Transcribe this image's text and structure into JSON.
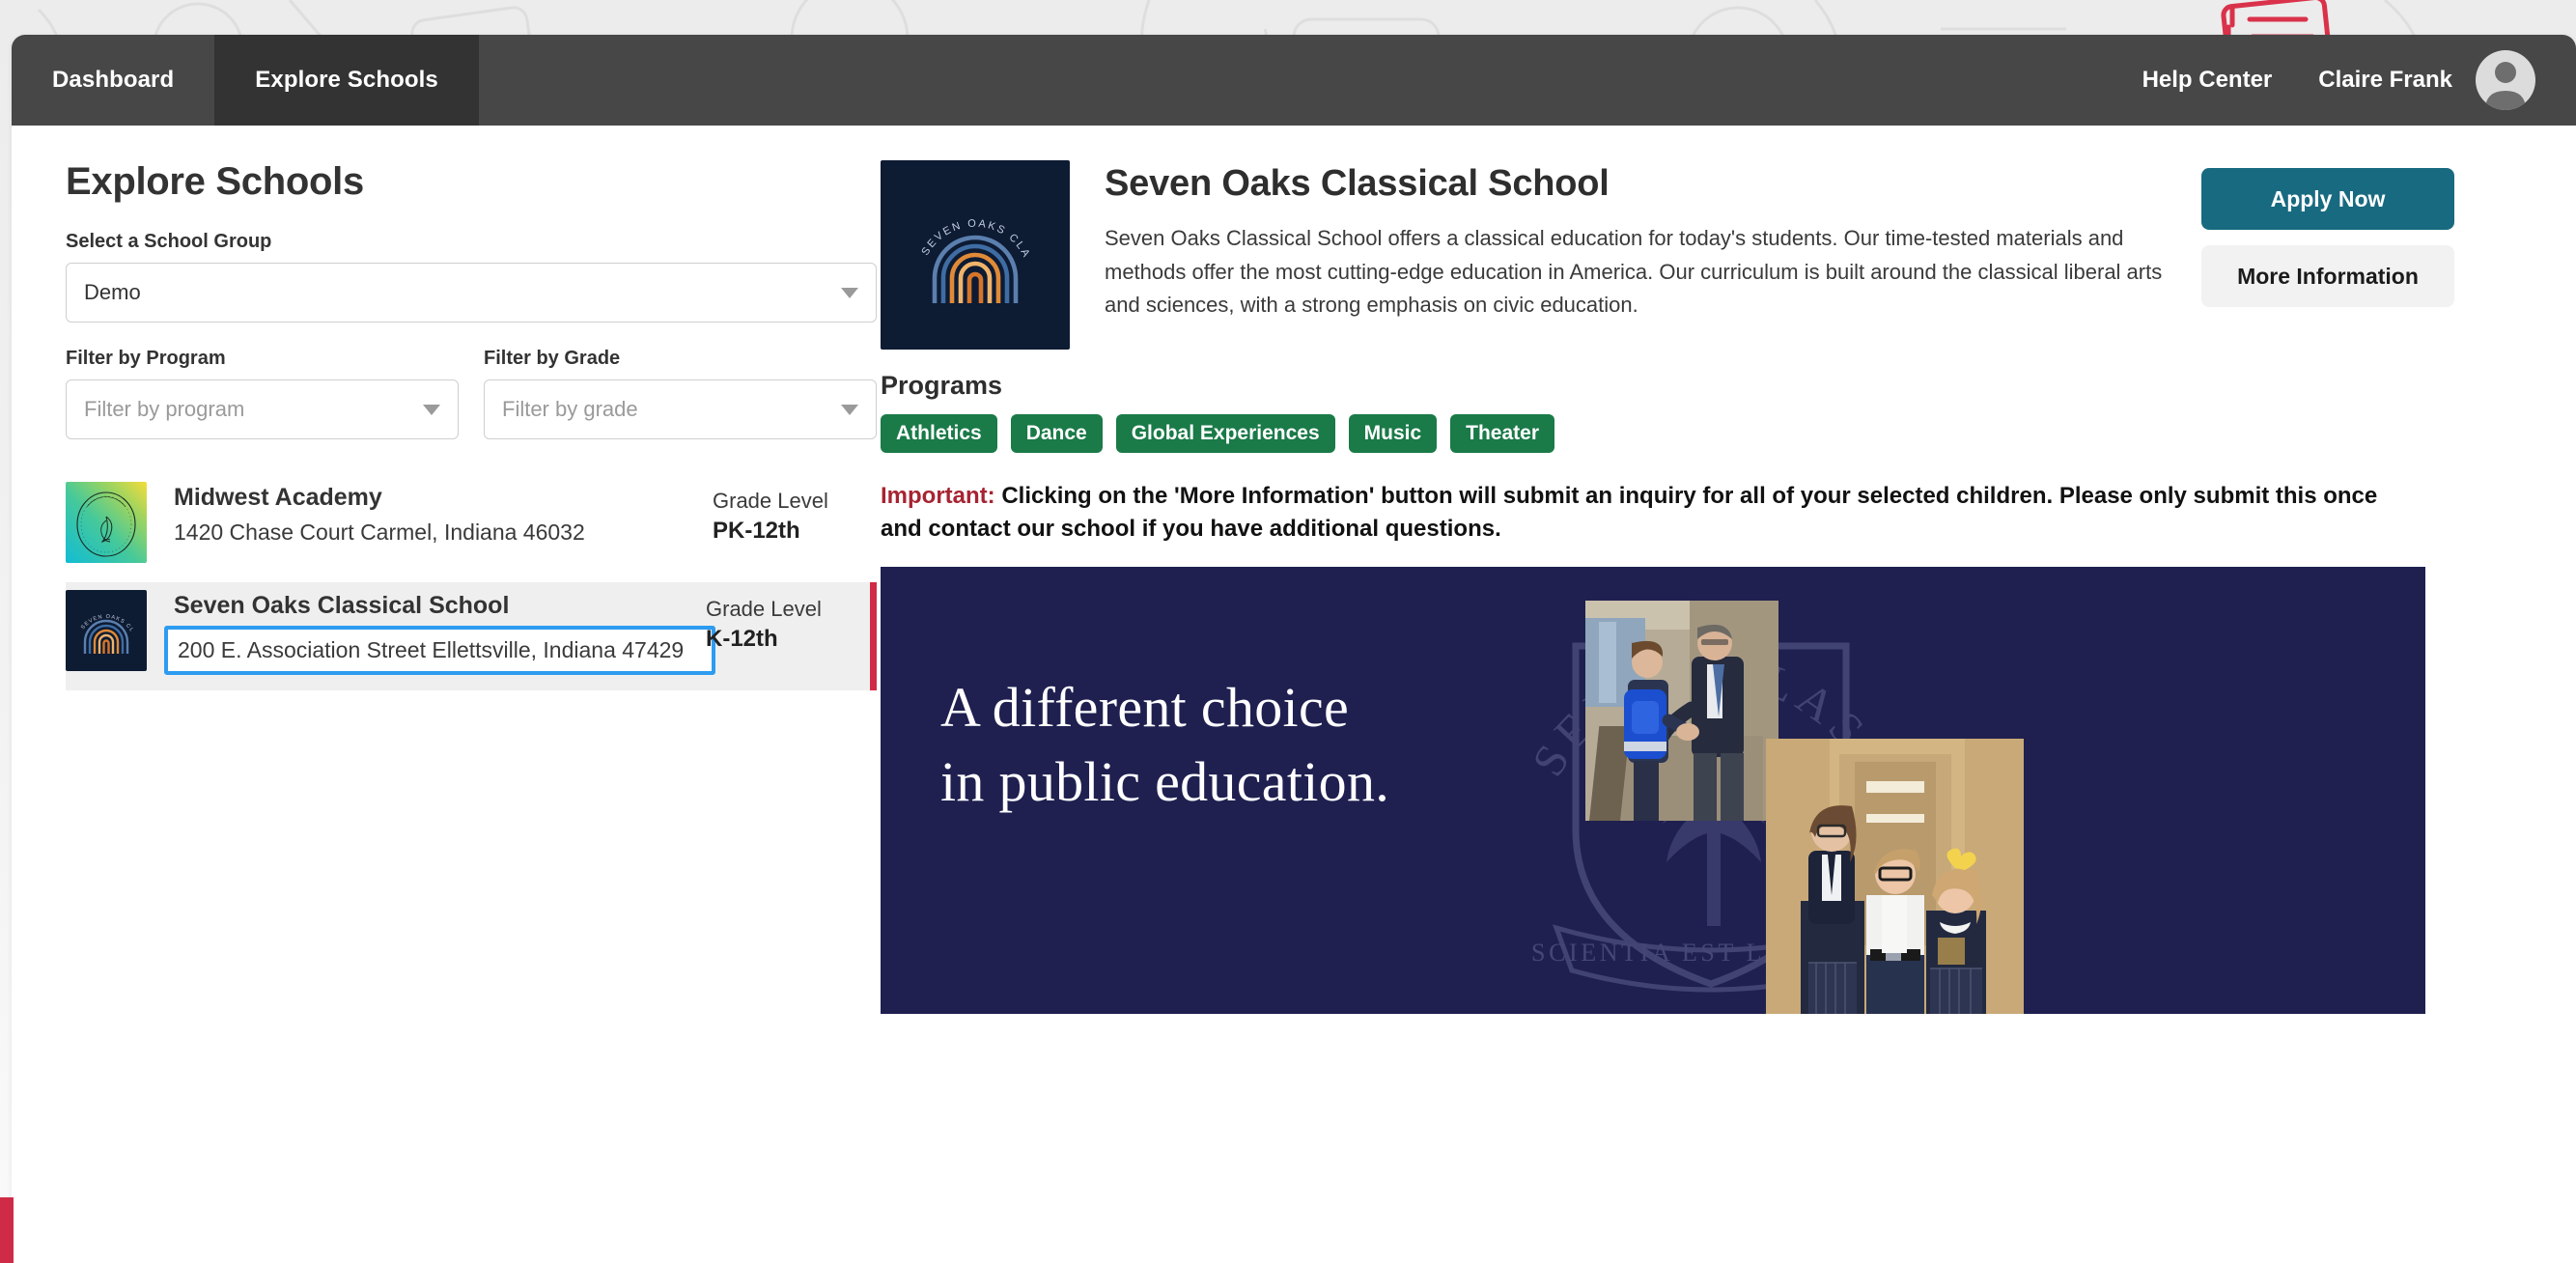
{
  "nav": {
    "tabs": [
      {
        "label": "Dashboard",
        "active": false
      },
      {
        "label": "Explore Schools",
        "active": true
      }
    ],
    "help_link": "Help Center",
    "user_name": "Claire Frank",
    "avatar_icon": "person-avatar-icon"
  },
  "page": {
    "title": "Explore Schools"
  },
  "filters": {
    "group_label": "Select a School Group",
    "group_value": "Demo",
    "program_label": "Filter by Program",
    "program_placeholder": "Filter by program",
    "grade_label": "Filter by Grade",
    "grade_placeholder": "Filter by grade",
    "caret_icon": "chevron-down-icon"
  },
  "school_list": [
    {
      "name": "Midwest Academy",
      "address": "1420 Chase Court Carmel, Indiana 46032",
      "grade_label": "Grade Level",
      "grade_value": "PK-12th",
      "logo_icon": "midwest-academy-logo",
      "selected": false,
      "address_focused": false
    },
    {
      "name": "Seven Oaks Classical School",
      "address": "200 E. Association Street Ellettsville, Indiana 47429",
      "grade_label": "Grade Level",
      "grade_value": "K-12th",
      "logo_icon": "seven-oaks-classical-logo",
      "selected": true,
      "address_focused": true
    }
  ],
  "detail": {
    "name": "Seven Oaks Classical School",
    "description": "Seven Oaks Classical School offers a classical education for today's students. Our time-tested materials and methods offer the most cutting-edge education in America. Our curriculum is built around the classical liberal arts and sciences, with a strong emphasis on civic education.",
    "logo_icon": "seven-oaks-classical-logo",
    "apply_label": "Apply Now",
    "more_info_label": "More Information",
    "programs_title": "Programs",
    "programs": [
      "Athletics",
      "Dance",
      "Global Experiences",
      "Music",
      "Theater"
    ],
    "notice_label": "Important:",
    "notice_text": "Clicking on the 'More Information' button will submit an inquiry for all of your selected children. Please only submit this once and contact our school if you have additional questions.",
    "banner": {
      "headline": "A different choice\nin public education.",
      "crest_motto": "SCIENTIA EST LIBERTAS",
      "crest_text_left": "SEVEN",
      "crest_text_arc": "CLASSICAL",
      "crest_text_right": "SCH"
    }
  },
  "colors": {
    "nav_bg": "#474747",
    "nav_active": "#333333",
    "apply_button": "#186a80",
    "more_info_button": "#f2f2f2",
    "program_tag": "#1a7a48",
    "accent_red": "#d02b46",
    "important_red": "#a62433",
    "focus_blue": "#2d9cf0",
    "banner_navy": "#1f2050",
    "logo_navy": "#0d1b33"
  }
}
